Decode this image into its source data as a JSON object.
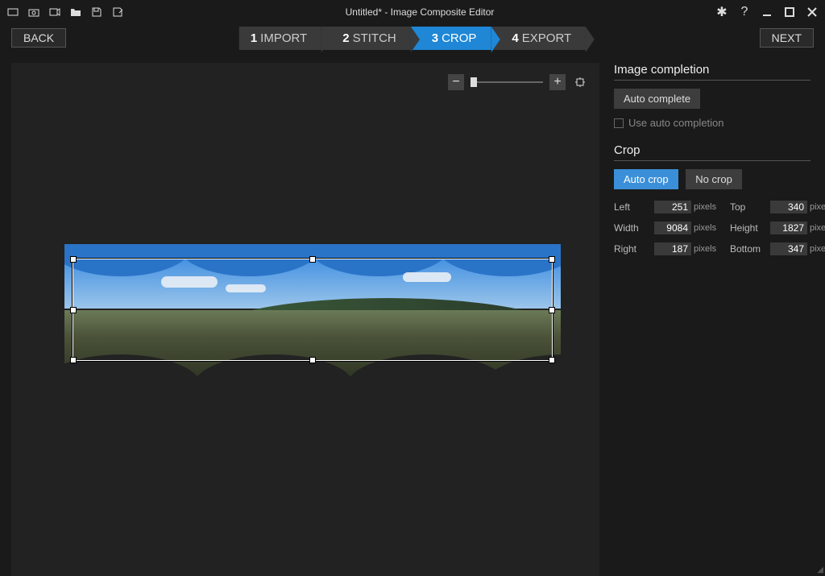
{
  "title": "Untitled* - Image Composite Editor",
  "nav": {
    "back": "BACK",
    "next": "NEXT"
  },
  "steps": [
    {
      "num": "1",
      "label": "IMPORT"
    },
    {
      "num": "2",
      "label": "STITCH"
    },
    {
      "num": "3",
      "label": "CROP"
    },
    {
      "num": "4",
      "label": "EXPORT"
    }
  ],
  "panel": {
    "completion_header": "Image completion",
    "auto_complete": "Auto complete",
    "use_auto": "Use auto completion",
    "crop_header": "Crop",
    "auto_crop": "Auto crop",
    "no_crop": "No crop",
    "unit": "pixels",
    "fields": {
      "left_label": "Left",
      "left_val": "251",
      "top_label": "Top",
      "top_val": "340",
      "width_label": "Width",
      "width_val": "9084",
      "height_label": "Height",
      "height_val": "1827",
      "right_label": "Right",
      "right_val": "187",
      "bottom_label": "Bottom",
      "bottom_val": "347"
    }
  }
}
